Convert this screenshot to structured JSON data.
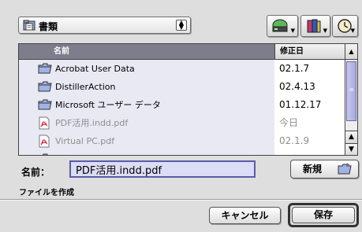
{
  "location": {
    "folder_label": "書類",
    "folder_icon": "documents-folder-icon"
  },
  "toolbar": {
    "buttons": [
      {
        "icon": "disk-icon"
      },
      {
        "icon": "favorites-icon"
      },
      {
        "icon": "clock-icon"
      }
    ]
  },
  "list": {
    "columns": {
      "name": "名前",
      "date": "修正日"
    },
    "sort_glyph": "▲",
    "rows": [
      {
        "name": "Acrobat User Data",
        "date": "02.1.7",
        "icon": "folder-icon",
        "dim": false
      },
      {
        "name": "DistillerAction",
        "date": "02.4.13",
        "icon": "folder-icon",
        "dim": false
      },
      {
        "name": "Microsoft ユーザー データ",
        "date": "01.12.17",
        "icon": "folder-icon",
        "dim": false
      },
      {
        "name": "PDF活用.indd.pdf",
        "date": "今日",
        "icon": "pdf-file-icon",
        "dim": true
      },
      {
        "name": "Virtual PC.pdf",
        "date": "02.1.9",
        "icon": "pdf-file-icon",
        "dim": true
      }
    ]
  },
  "form": {
    "name_caption": "名前：",
    "filename_value": "PDF活用.indd.pdf",
    "new_button_label": "新規",
    "status_text": "ファイルを作成"
  },
  "actions": {
    "cancel_label": "キャンセル",
    "save_label": "保存"
  },
  "colors": {
    "header_accent": "#7d7d8c",
    "selection": "#dcdcf6",
    "row_tint": "#e9e9f4"
  }
}
